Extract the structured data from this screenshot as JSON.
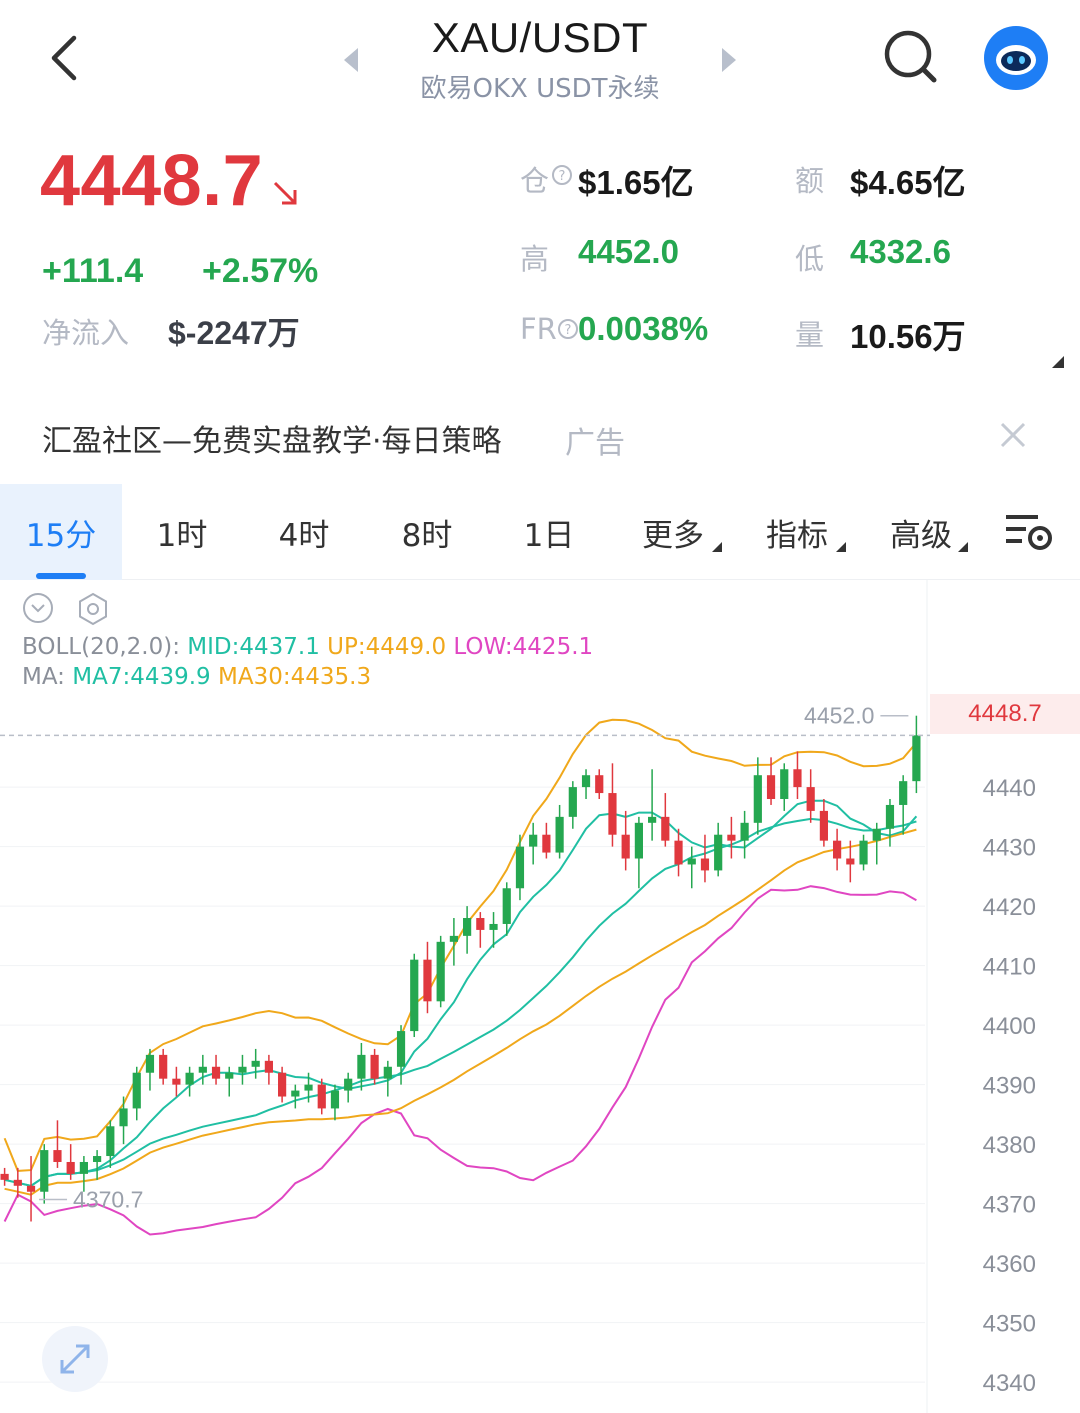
{
  "header": {
    "title": "XAU/USDT",
    "subtitle": "欧易OKX USDT永续"
  },
  "quote": {
    "price": "4448.7",
    "change": "+111.4",
    "change_pct": "+2.57%",
    "netflow_label": "净流入",
    "netflow_value": "$-2247万",
    "stats": {
      "oi_label": "仓",
      "oi_value": "$1.65亿",
      "turnover_label": "额",
      "turnover_value": "$4.65亿",
      "high_label": "高",
      "high_value": "4452.0",
      "low_label": "低",
      "low_value": "4332.6",
      "fr_label": "FR",
      "fr_value": "0.0038%",
      "volume_label": "量",
      "volume_value": "10.56万"
    }
  },
  "ad": {
    "text": "汇盈社区—免费实盘教学·每日策略",
    "tag": "广告"
  },
  "tabs": [
    {
      "label": "15分",
      "active": true
    },
    {
      "label": "1时"
    },
    {
      "label": "4时"
    },
    {
      "label": "8时"
    },
    {
      "label": "1日"
    },
    {
      "label": "更多"
    },
    {
      "label": "指标"
    },
    {
      "label": "高级"
    }
  ],
  "legend": {
    "boll_label": "BOLL(20,2.0):",
    "mid": "MID:4437.1",
    "up": "UP:4449.0",
    "low": "LOW:4425.1",
    "ma_label": "MA:",
    "ma7": "MA7:4439.9",
    "ma30": "MA30:4435.3"
  },
  "colors": {
    "up": "#25a750",
    "down": "#e0383e",
    "accent": "#1e7ef5",
    "mid": "#20bfa3",
    "upper": "#f0a81b",
    "lower": "#e046c2"
  },
  "icons": {
    "back": "chevron-left-icon",
    "search": "search-icon",
    "avatar": "robot-avatar-icon",
    "close": "close-icon",
    "chart_settings": "chart-settings-icon",
    "expand": "expand-icon"
  },
  "chart_data": {
    "type": "candlestick",
    "y_ticks": [
      "4440",
      "4430",
      "4420",
      "4410",
      "4400",
      "4390",
      "4380",
      "4370",
      "4360",
      "4350",
      "4340"
    ],
    "ylim": [
      4337,
      4458
    ],
    "high_marker": "4452.0",
    "low_marker": "4370.7",
    "last_price": "4448.7",
    "candles": [
      [
        4375,
        4376,
        4373,
        4374
      ],
      [
        4374,
        4376,
        4371,
        4373
      ],
      [
        4373,
        4378,
        4367,
        4372
      ],
      [
        4372,
        4380,
        4370,
        4379
      ],
      [
        4379,
        4384,
        4376,
        4377
      ],
      [
        4377,
        4380,
        4374,
        4375
      ],
      [
        4375,
        4378,
        4372,
        4377
      ],
      [
        4377,
        4379,
        4374,
        4378
      ],
      [
        4378,
        4384,
        4376,
        4383
      ],
      [
        4383,
        4388,
        4380,
        4386
      ],
      [
        4386,
        4393,
        4384,
        4392
      ],
      [
        4392,
        4396,
        4389,
        4395
      ],
      [
        4395,
        4396,
        4390,
        4391
      ],
      [
        4391,
        4393,
        4388,
        4390
      ],
      [
        4390,
        4393,
        4388,
        4392
      ],
      [
        4392,
        4395,
        4390,
        4393
      ],
      [
        4393,
        4395,
        4390,
        4391
      ],
      [
        4391,
        4393,
        4388,
        4392
      ],
      [
        4392,
        4395,
        4390,
        4393
      ],
      [
        4393,
        4396,
        4391,
        4394
      ],
      [
        4394,
        4395,
        4390,
        4392
      ],
      [
        4392,
        4393,
        4387,
        4388
      ],
      [
        4388,
        4390,
        4386,
        4389
      ],
      [
        4389,
        4392,
        4387,
        4390
      ],
      [
        4390,
        4391,
        4385,
        4386
      ],
      [
        4386,
        4390,
        4384,
        4389
      ],
      [
        4389,
        4392,
        4387,
        4391
      ],
      [
        4391,
        4397,
        4389,
        4395
      ],
      [
        4395,
        4396,
        4390,
        4391
      ],
      [
        4391,
        4394,
        4388,
        4393
      ],
      [
        4393,
        4400,
        4390,
        4399
      ],
      [
        4399,
        4412,
        4398,
        4411
      ],
      [
        4411,
        4414,
        4402,
        4404
      ],
      [
        4404,
        4415,
        4403,
        4414
      ],
      [
        4414,
        4418,
        4410,
        4415
      ],
      [
        4415,
        4420,
        4412,
        4418
      ],
      [
        4418,
        4419,
        4413,
        4416
      ],
      [
        4416,
        4419,
        4413,
        4417
      ],
      [
        4417,
        4424,
        4415,
        4423
      ],
      [
        4423,
        4432,
        4421,
        4430
      ],
      [
        4430,
        4434,
        4427,
        4432
      ],
      [
        4432,
        4434,
        4428,
        4429
      ],
      [
        4429,
        4437,
        4428,
        4435
      ],
      [
        4435,
        4441,
        4433,
        4440
      ],
      [
        4440,
        4443,
        4438,
        4442
      ],
      [
        4442,
        4443,
        4438,
        4439
      ],
      [
        4439,
        4444,
        4430,
        4432
      ],
      [
        4432,
        4436,
        4426,
        4428
      ],
      [
        4428,
        4435,
        4423,
        4434
      ],
      [
        4434,
        4443,
        4431,
        4435
      ],
      [
        4435,
        4439,
        4430,
        4431
      ],
      [
        4431,
        4433,
        4425,
        4427
      ],
      [
        4427,
        4430,
        4423,
        4428
      ],
      [
        4428,
        4432,
        4424,
        4426
      ],
      [
        4426,
        4434,
        4425,
        4432
      ],
      [
        4432,
        4435,
        4428,
        4431
      ],
      [
        4431,
        4436,
        4428,
        4434
      ],
      [
        4434,
        4445,
        4432,
        4442
      ],
      [
        4442,
        4445,
        4437,
        4438
      ],
      [
        4438,
        4444,
        4436,
        4443
      ],
      [
        4443,
        4446,
        4438,
        4440
      ],
      [
        4440,
        4443,
        4434,
        4436
      ],
      [
        4436,
        4438,
        4430,
        4431
      ],
      [
        4431,
        4433,
        4426,
        4428
      ],
      [
        4428,
        4431,
        4424,
        4427
      ],
      [
        4427,
        4432,
        4426,
        4431
      ],
      [
        4431,
        4434,
        4427,
        4433
      ],
      [
        4433,
        4438,
        4430,
        4437
      ],
      [
        4437,
        4442,
        4432,
        4441
      ],
      [
        4441,
        4452,
        4439,
        4448.7
      ]
    ]
  }
}
